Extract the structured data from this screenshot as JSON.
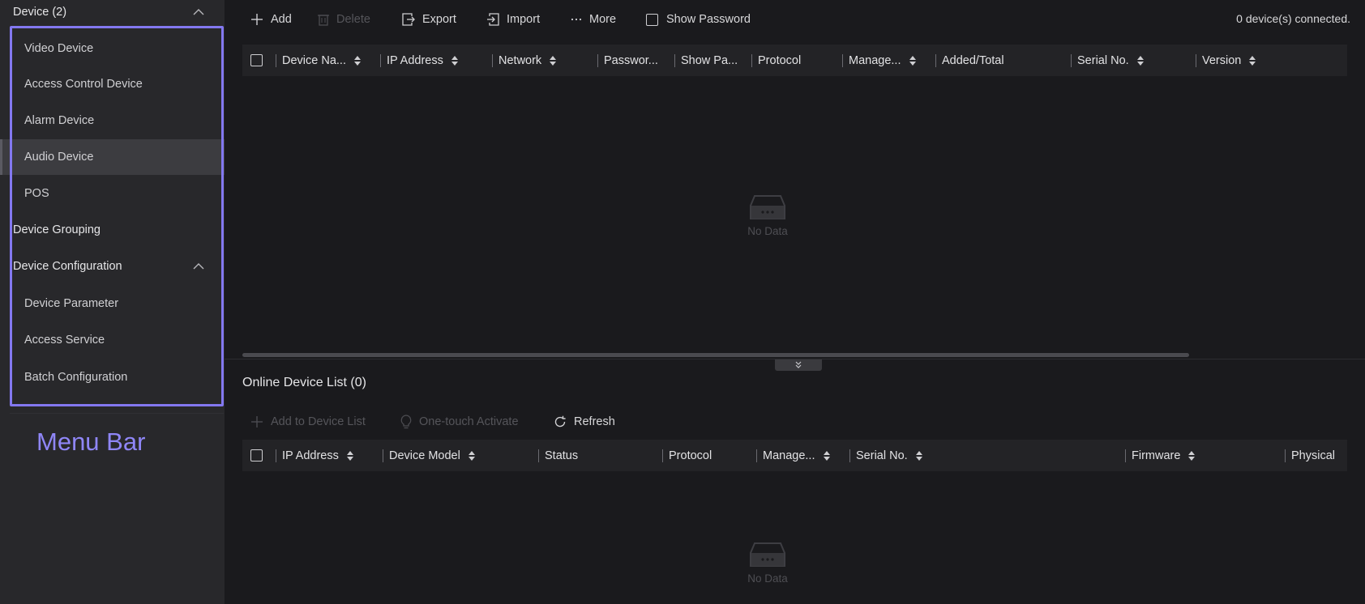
{
  "sidebar": {
    "device_group": {
      "label": "Device (2)",
      "expanded": true
    },
    "device_items": [
      {
        "label": "Video Device"
      },
      {
        "label": "Access Control Device"
      },
      {
        "label": "Alarm Device"
      },
      {
        "label": "Audio Device",
        "selected": true
      },
      {
        "label": "POS"
      }
    ],
    "grouping": {
      "label": "Device Grouping"
    },
    "config_group": {
      "label": "Device Configuration",
      "expanded": true
    },
    "config_items": [
      {
        "label": "Device Parameter"
      },
      {
        "label": "Access Service"
      },
      {
        "label": "Batch Configuration"
      }
    ],
    "annotation": "Menu Bar"
  },
  "toolbar": {
    "add": "Add",
    "delete": "Delete",
    "export": "Export",
    "import": "Import",
    "more": "More",
    "show_password": "Show Password",
    "status": "0 device(s) connected."
  },
  "device_table": {
    "columns": [
      "Device Na...",
      "IP Address",
      "Network",
      "Passwor...",
      "Show Pa...",
      "Protocol",
      "Manage...",
      "Added/Total",
      "Serial No.",
      "Version"
    ],
    "empty_text": "No Data"
  },
  "online": {
    "title": "Online Device List (0)",
    "add_to_list": "Add to Device List",
    "activate": "One-touch Activate",
    "refresh": "Refresh",
    "columns": [
      "IP Address",
      "Device Model",
      "Status",
      "Protocol",
      "Manage...",
      "Serial No.",
      "Firmware",
      "Physical"
    ],
    "empty_text": "No Data"
  },
  "colors": {
    "highlight": "#8378f0",
    "annotation_text": "#8f86f7",
    "sidebar_bg": "#28282b",
    "main_bg": "#1a1a1d"
  }
}
